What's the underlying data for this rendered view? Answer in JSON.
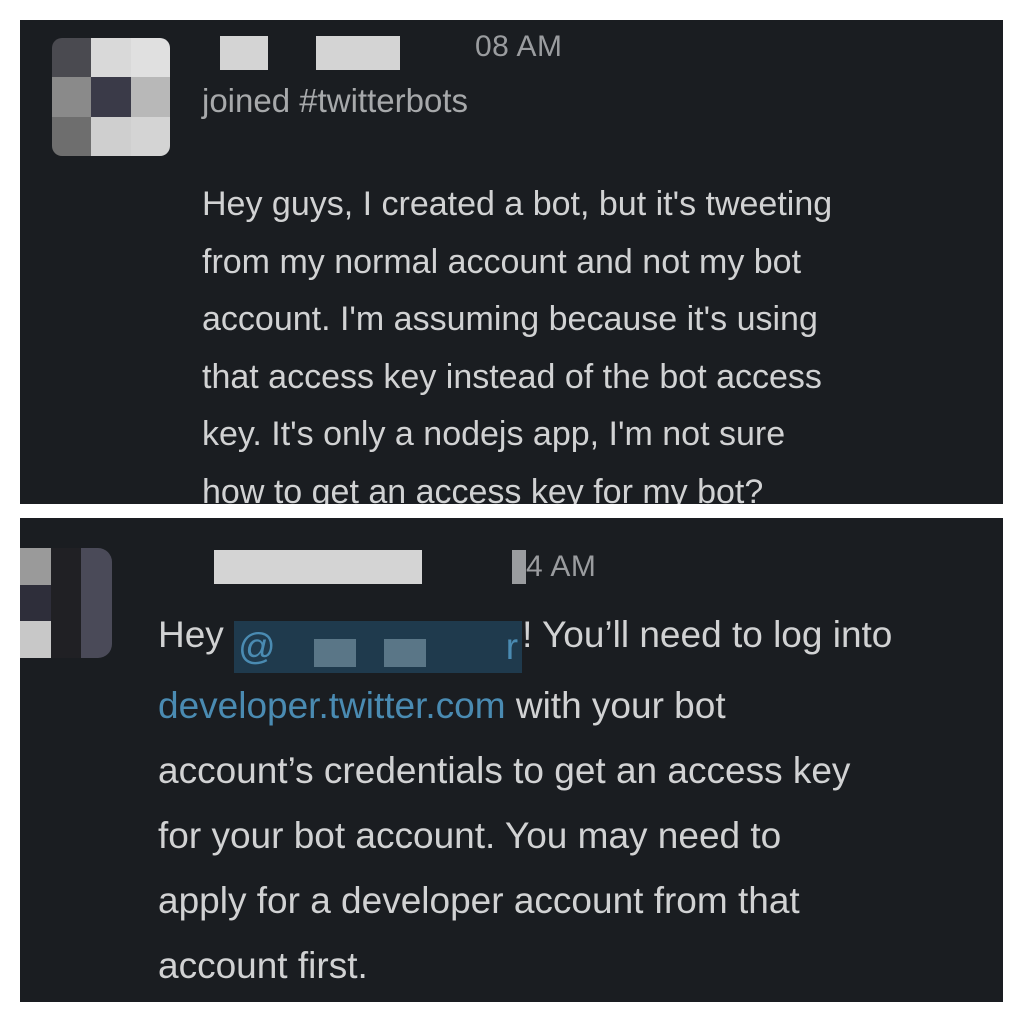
{
  "colors": {
    "panel_bg": "#1a1d21",
    "text": "#d1d2d3",
    "muted_text": "#9a9c9f",
    "link": "#4a8bb2",
    "mention_bg": "#1f3a4d"
  },
  "message_top": {
    "timestamp": "08 AM",
    "system_text": "joined #twitterbots",
    "lines": [
      "Hey guys, I created a bot, but it's tweeting",
      "from my normal account and not my bot",
      "account. I'm assuming because it's using",
      "that access key instead of the bot access",
      "key. It's only  a nodejs app, I'm not sure",
      "how to get an access key for my bot?"
    ]
  },
  "message_bottom": {
    "timestamp": "4 AM",
    "greeting": "Hey ",
    "mention_prefix": "@",
    "mention_suffix": "r",
    "line1_rest": "! You’ll need to log into",
    "link_text": "developer.twitter.com",
    "line2_rest": " with your bot",
    "lines": [
      "account’s credentials to get an access key",
      "for your bot account. You may need to",
      "apply for a developer account from that",
      "account first."
    ]
  }
}
